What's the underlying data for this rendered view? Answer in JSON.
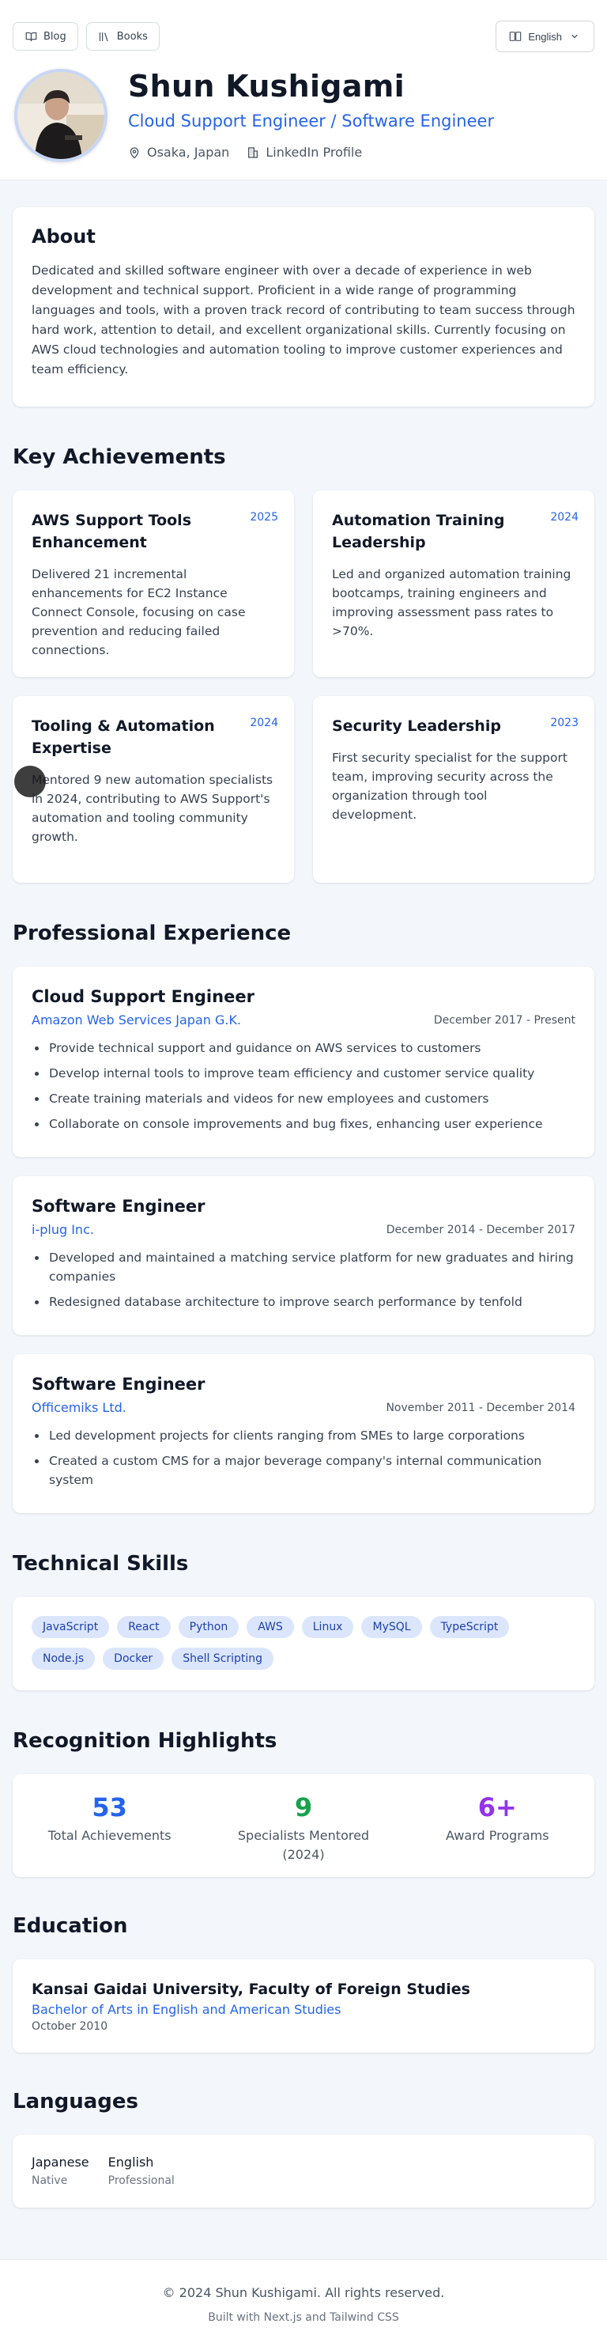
{
  "nav": {
    "blog_label": "Blog",
    "books_label": "Books",
    "language_label": "English"
  },
  "profile": {
    "name": "Shun Kushigami",
    "role": "Cloud Support Engineer / Software Engineer",
    "location": "Osaka, Japan",
    "linkedin_label": "LinkedIn Profile"
  },
  "about": {
    "title": "About",
    "text": "Dedicated and skilled software engineer with over a decade of experience in web development and technical support. Proficient in a wide range of programming languages and tools, with a proven track record of contributing to team success through hard work, attention to detail, and excellent organizational skills. Currently focusing on AWS cloud technologies and automation tooling to improve customer experiences and team efficiency."
  },
  "achievements": {
    "title": "Key Achievements",
    "items": [
      {
        "title": "AWS Support Tools Enhancement",
        "year": "2025",
        "desc": "Delivered 21 incremental enhancements for EC2 Instance Connect Console, focusing on case prevention and reducing failed connections."
      },
      {
        "title": "Automation Training Leadership",
        "year": "2024",
        "desc": "Led and organized automation training bootcamps, training engineers and improving assessment pass rates to >70%."
      },
      {
        "title": "Tooling & Automation Expertise",
        "year": "2024",
        "desc": "Mentored 9 new automation specialists in 2024, contributing to AWS Support's automation and tooling community growth."
      },
      {
        "title": "Security Leadership",
        "year": "2023",
        "desc": "First security specialist for the support team, improving security across the organization through tool development."
      }
    ]
  },
  "experience": {
    "title": "Professional Experience",
    "items": [
      {
        "role": "Cloud Support Engineer",
        "company": "Amazon Web Services Japan G.K.",
        "dates": "December 2017 - Present",
        "bullets": [
          "Provide technical support and guidance on AWS services to customers",
          "Develop internal tools to improve team efficiency and customer service quality",
          "Create training materials and videos for new employees and customers",
          "Collaborate on console improvements and bug fixes, enhancing user experience"
        ]
      },
      {
        "role": "Software Engineer",
        "company": "i-plug Inc.",
        "dates": "December 2014 - December 2017",
        "bullets": [
          "Developed and maintained a matching service platform for new graduates and hiring companies",
          "Redesigned database architecture to improve search performance by tenfold"
        ]
      },
      {
        "role": "Software Engineer",
        "company": "Officemiks Ltd.",
        "dates": "November 2011 - December 2014",
        "bullets": [
          "Led development projects for clients ranging from SMEs to large corporations",
          "Created a custom CMS for a major beverage company's internal communication system"
        ]
      }
    ]
  },
  "skills": {
    "title": "Technical Skills",
    "items": [
      "JavaScript",
      "React",
      "Python",
      "AWS",
      "Linux",
      "MySQL",
      "TypeScript",
      "Node.js",
      "Docker",
      "Shell Scripting"
    ]
  },
  "recognition": {
    "title": "Recognition Highlights",
    "stats": [
      {
        "value": "53",
        "label": "Total Achievements",
        "color": "#2563eb"
      },
      {
        "value": "9",
        "label": "Specialists Mentored (2024)",
        "color": "#16a34a"
      },
      {
        "value": "6+",
        "label": "Award Programs",
        "color": "#9333ea"
      }
    ]
  },
  "education": {
    "title": "Education",
    "school": "Kansai Gaidai University, Faculty of Foreign Studies",
    "degree": "Bachelor of Arts in English and American Studies",
    "date": "October 2010"
  },
  "languages": {
    "title": "Languages",
    "items": [
      {
        "name": "Japanese",
        "level": "Native"
      },
      {
        "name": "English",
        "level": "Professional"
      }
    ]
  },
  "footer": {
    "copyright": "© 2024 Shun Kushigami. All rights reserved.",
    "built_with": "Built with Next.js and Tailwind CSS"
  }
}
